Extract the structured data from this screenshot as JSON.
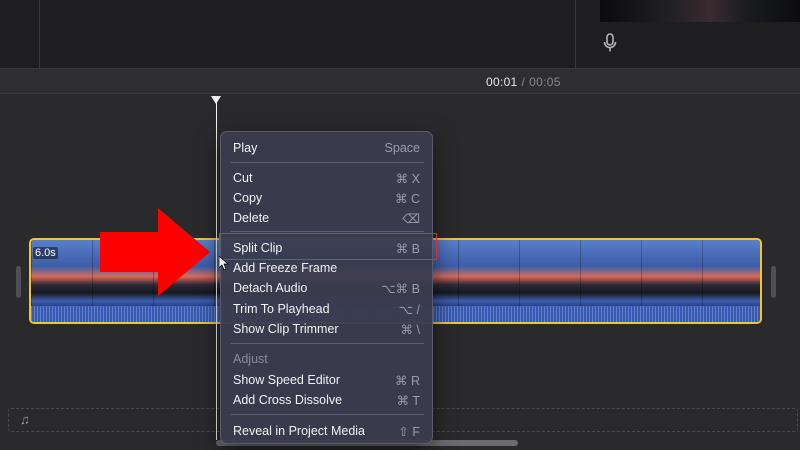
{
  "timecode": {
    "current": "00:01",
    "separator": "/",
    "total": "00:05"
  },
  "clip": {
    "duration_label": "6.0s"
  },
  "colors": {
    "clip_border": "#f3c432",
    "arrow": "#ff0000",
    "highlight_box": "#d9322e"
  },
  "icons": {
    "mic": "microphone-icon",
    "music": "music-note-icon",
    "cursor": "mouse-pointer-icon",
    "arrow": "annotation-arrow-icon"
  },
  "music_note_glyph": "♫",
  "menu": {
    "items": [
      {
        "label": "Play",
        "shortcut": "Space"
      },
      {
        "label": "Cut",
        "shortcut": "⌘ X"
      },
      {
        "label": "Copy",
        "shortcut": "⌘ C"
      },
      {
        "label": "Delete",
        "shortcut": "⌫"
      },
      {
        "label": "Split Clip",
        "shortcut": "⌘ B"
      },
      {
        "label": "Add Freeze Frame",
        "shortcut": ""
      },
      {
        "label": "Detach Audio",
        "shortcut": "⌥⌘ B"
      },
      {
        "label": "Trim To Playhead",
        "shortcut": "⌥  /"
      },
      {
        "label": "Show Clip Trimmer",
        "shortcut": "⌘ \\"
      },
      {
        "label": "Adjust",
        "shortcut": ""
      },
      {
        "label": "Show Speed Editor",
        "shortcut": "⌘ R"
      },
      {
        "label": "Add Cross Dissolve",
        "shortcut": "⌘ T"
      },
      {
        "label": "Reveal in Project Media",
        "shortcut": "⇧ F"
      }
    ]
  }
}
